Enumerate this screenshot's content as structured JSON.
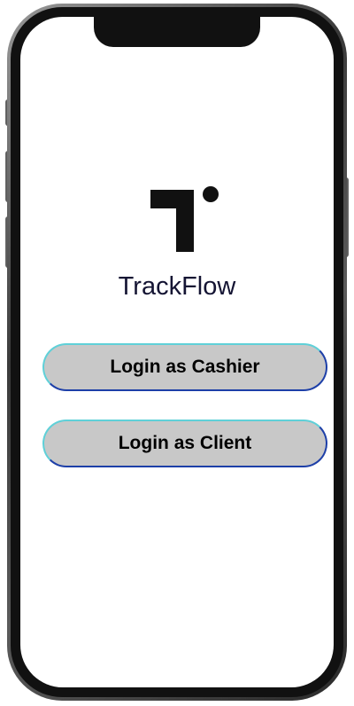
{
  "app": {
    "name": "TrackFlow",
    "logo_icon": "trackflow-logo-icon"
  },
  "actions": {
    "cashier_label": "Login as Cashier",
    "client_label": "Login as Client"
  },
  "colors": {
    "button_fill": "#c8c8c8",
    "button_border_light": "#5fd0d8",
    "button_border_dark": "#1d3fa8",
    "logo": "#111111",
    "title_text": "#141433"
  }
}
